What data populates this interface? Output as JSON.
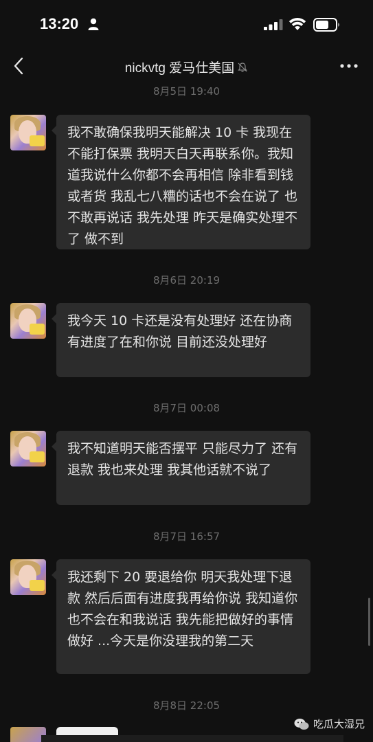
{
  "status_bar": {
    "time": "13:20"
  },
  "header": {
    "title": "nickvtg 爱马仕美国",
    "icons": [
      "back-icon",
      "mute-bell-icon",
      "more-icon"
    ]
  },
  "messages": [
    {
      "timestamp": "8月5日 19:40",
      "text": "我不敢确保我明天能解决 10 卡 我现在不能打保票 我明天白天再联系你。我知道我说什么你都不会再相信 除非看到钱或者货 我乱七八糟的话也不会在说了 也不敢再说话 我先处理 昨天是确实处理不了 做不到"
    },
    {
      "timestamp": "8月6日 20:19",
      "text": "我今天 10 卡还是没有处理好 还在协商 有进度了在和你说 目前还没处理好"
    },
    {
      "timestamp": "8月7日 00:08",
      "text": "我不知道明天能否摆平 只能尽力了 还有退款 我也来处理 我其他话就不说了"
    },
    {
      "timestamp": "8月7日 16:57",
      "text": "我还剩下 20 要退给你 明天我处理下退款 然后后面有进度我再给你说 我知道你也不会在和我说话 我先能把做好的事情做好 ...今天是你没理我的第二天"
    }
  ],
  "last_timestamp": "8月8日 22:05",
  "watermark": "吃瓜大湿兄",
  "colors": {
    "background": "#111111",
    "bubble": "#2c2c2c",
    "timestamp": "#6d6d6d",
    "text": "#e4e4e4"
  }
}
